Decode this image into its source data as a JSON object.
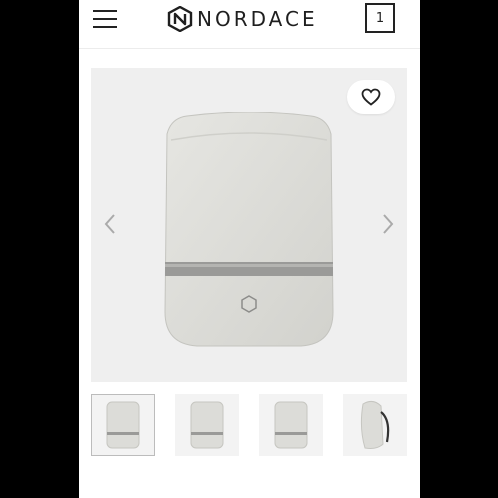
{
  "header": {
    "brand": "NORDACE",
    "cart_count": "1",
    "menu_icon": "hamburger-menu-icon",
    "logo_icon": "nordace-logo-icon"
  },
  "gallery": {
    "favorite_icon": "heart-outline-icon",
    "prev_icon": "chevron-left-icon",
    "next_icon": "chevron-right-icon",
    "product_image": "gray-backpack-rain-cover",
    "thumbnails": [
      {
        "image": "backpack-front-view",
        "active": true
      },
      {
        "image": "backpack-front-view-2",
        "active": false
      },
      {
        "image": "backpack-front-view-3",
        "active": false
      },
      {
        "image": "backpack-side-view",
        "active": false
      }
    ]
  },
  "colors": {
    "background": "#ffffff",
    "gallery_bg": "#efefef",
    "text": "#1f1f1f",
    "product": "#dcdcd8"
  }
}
